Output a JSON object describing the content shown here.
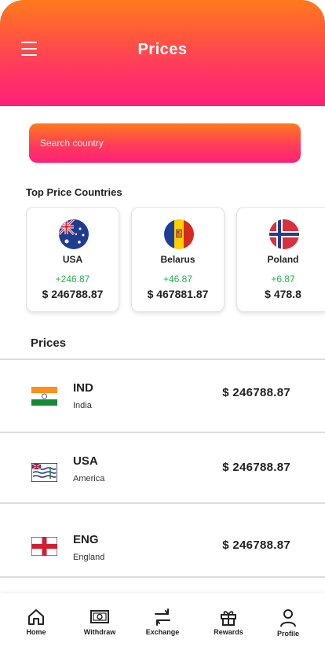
{
  "header": {
    "title": "Prices",
    "menu_icon": "hamburger-menu-icon"
  },
  "search": {
    "placeholder": "Search country"
  },
  "top_countries": {
    "title": "Top Price Countries",
    "cards": [
      {
        "name": "USA",
        "change": "+246.87",
        "price": "$ 246788.87",
        "flag_icon": "australia-flag-icon"
      },
      {
        "name": "Belarus",
        "change": "+46.87",
        "price": "$ 467881.87",
        "flag_icon": "andorra-flag-icon"
      },
      {
        "name": "Poland",
        "change": "+6.87",
        "price": "$ 478.8",
        "flag_icon": "norway-flag-icon"
      }
    ]
  },
  "prices": {
    "title": "Prices",
    "rows": [
      {
        "code": "IND",
        "name": "India",
        "amount": "$ 246788.87",
        "flag_icon": "india-flag-icon"
      },
      {
        "code": "USA",
        "name": "America",
        "amount": "$ 246788.87",
        "flag_icon": "british-indian-ocean-flag-icon"
      },
      {
        "code": "ENG",
        "name": "England",
        "amount": "$ 246788.87",
        "flag_icon": "england-flag-icon"
      }
    ]
  },
  "nav": {
    "items": [
      {
        "label": "Home",
        "icon": "home-icon"
      },
      {
        "label": "Withdraw",
        "icon": "banknote-icon"
      },
      {
        "label": "Exchange",
        "icon": "exchange-arrows-icon"
      },
      {
        "label": "Rewards",
        "icon": "gift-icon"
      },
      {
        "label": "Profile",
        "icon": "user-icon"
      }
    ]
  },
  "colors": {
    "gradient_top": "#ff7a1a",
    "gradient_bottom": "#ff1f7a",
    "positive": "#23b14d"
  }
}
